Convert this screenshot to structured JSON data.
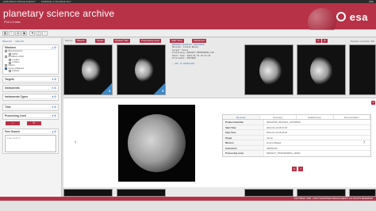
{
  "topbar": {
    "agency": "EUROPEAN SPACE AGENCY",
    "science": "SCIENCE & TECHNOLOGY",
    "right": "DBE"
  },
  "header": {
    "title": "planetary science archive",
    "subtitle": "PSA 3.0 beta",
    "logo": "esa"
  },
  "toolbar": {
    "icons": [
      "grid-icon",
      "list-icon",
      "globe-icon",
      "image-icon",
      "hand-icon",
      "layers-icon",
      "help-icon"
    ]
  },
  "sidebar": {
    "show_all": "Show All",
    "hide_all": "Hide All",
    "missions": {
      "title": "Missions",
      "items": [
        {
          "label": "BepiColombo",
          "checked": false
        },
        {
          "label": "MPO",
          "checked": false
        },
        {
          "label": "ExoMars 2016",
          "checked": false
        },
        {
          "label": "Lander",
          "checked": false
        },
        {
          "label": "Orbiter",
          "checked": false
        },
        {
          "label": "Giotto",
          "checked": false
        },
        {
          "label": "Ground-Based",
          "checked": true
        },
        {
          "label": "DRAG",
          "checked": false
        }
      ]
    },
    "targets": "Targets",
    "instruments": "Instruments",
    "instrument_types": "Instruments Types",
    "time": "Time",
    "processing_level": "Processing Level",
    "free_search": "Free Search",
    "free_search_placeholder": "Free Search"
  },
  "filter_bar": {
    "sort_by": "Sort by",
    "buttons": [
      "Mission",
      "Target",
      "Product Title",
      "Processing Level",
      "Start Time",
      "Instrument"
    ],
    "results": "Number of results: 415"
  },
  "selected_meta": {
    "id": "DRAGO90_20130113_133748040",
    "lines": [
      "Mission: Ground Based",
      "Target: Venus",
      "Processing: DEFAULT_PROCESSING_LEV",
      "Start Time: 2013-01-13 18:27:29",
      "Instrument: AMATEUR"
    ],
    "add": "ADD TO DOWNLOADS"
  },
  "detail": {
    "tabs": [
      "Summary",
      "Geometry",
      "Related prod.",
      "Documentation"
    ],
    "rows": [
      {
        "k": "Product Identifier",
        "v": "DRAGO90_20130113_133748040"
      },
      {
        "k": "Start Time",
        "v": "2013-01-13 18:27:29"
      },
      {
        "k": "Stop Time",
        "v": "2013-01-13 18:29:20"
      },
      {
        "k": "Target",
        "v": "Venus"
      },
      {
        "k": "Mission",
        "v": "Ground Based"
      },
      {
        "k": "Instrument",
        "v": "AMATEUR"
      },
      {
        "k": "Processing Level",
        "v": "DEFAULT_PROCESSING_LEVEL"
      }
    ]
  },
  "footer": "COPYRIGHT 2006 - 2016 © EUROPEAN SPACE AGENCY. ALL RIGHTS RESERVED"
}
